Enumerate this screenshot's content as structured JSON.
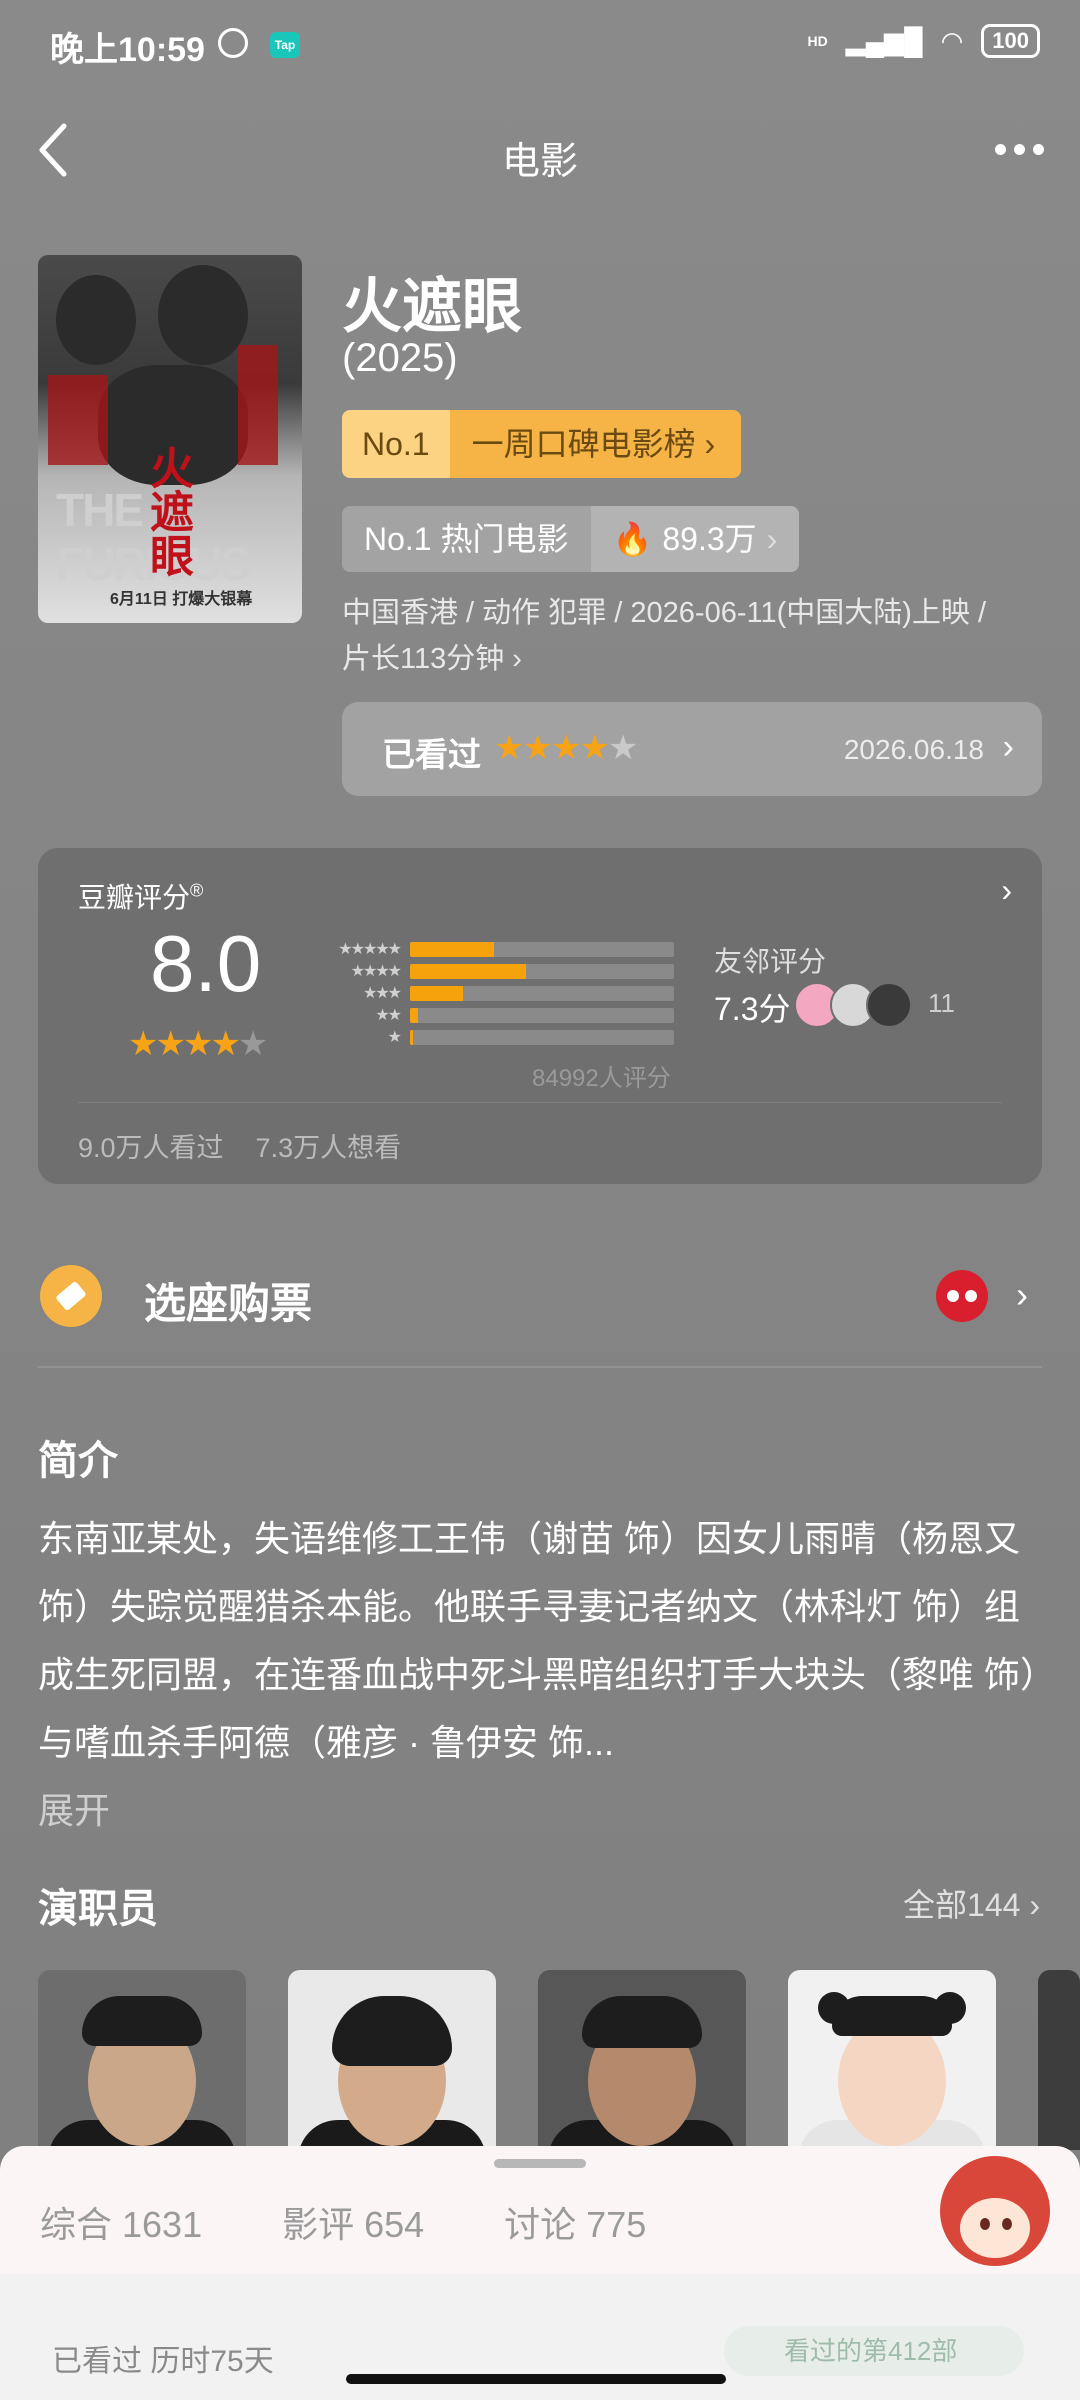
{
  "status": {
    "time": "晚上10:59",
    "network": "HD",
    "battery": "100",
    "tap_badge": "Tap"
  },
  "header": {
    "title": "电影"
  },
  "movie": {
    "title": "火遮眼",
    "year": "(2025)",
    "poster_text_en": "THE FURIOUS",
    "poster_text_cn": "火遮眼",
    "poster_date": "6月11日 打爆大银幕",
    "rank": {
      "no": "No.1",
      "label": "一周口碑电影榜"
    },
    "hot": {
      "label": "No.1 热门电影",
      "count": "89.3万"
    },
    "meta_line1": "中国香港 / 动作 犯罪 / 2026-06-11(中国大陆)上映 /",
    "meta_line2": "片长113分钟",
    "watched": {
      "label": "已看过",
      "stars": 4,
      "date": "2026.06.18"
    }
  },
  "rating": {
    "title": "豆瓣评分",
    "registered": "®",
    "score": "8.0",
    "stars": 4,
    "distribution": [
      0.32,
      0.44,
      0.2,
      0.03,
      0.01
    ],
    "count_label": "84992人评分",
    "friends_title": "友邻评分",
    "friends_score": "7.3分",
    "friends_count": "11",
    "watched": "9.0万人看过",
    "want": "7.3万人想看"
  },
  "ticket": {
    "label": "选座购票"
  },
  "summary": {
    "title": "简介",
    "text": "东南亚某处，失语维修工王伟（谢苗 饰）因女儿雨晴（杨恩又 饰）失踪觉醒猎杀本能。他联手寻妻记者纳文（林科灯 饰）组成生死同盟，在连番血战中死斗黑暗组织打手大块头（黎唯 饰）与嗜血杀手阿德（雅彦 · 鲁伊安 饰...",
    "more": "展开"
  },
  "cast": {
    "title": "演职员",
    "all": "全部144"
  },
  "tabs": {
    "items": [
      "综合 1631",
      "影评 654",
      "讨论 775"
    ]
  },
  "under": {
    "left": "已看过 历时75天",
    "right": "看过的第412部"
  },
  "colors": {
    "accent": "#f5a20d",
    "rank_bg": "#f5b445",
    "cat_red": "#d91f2e"
  }
}
